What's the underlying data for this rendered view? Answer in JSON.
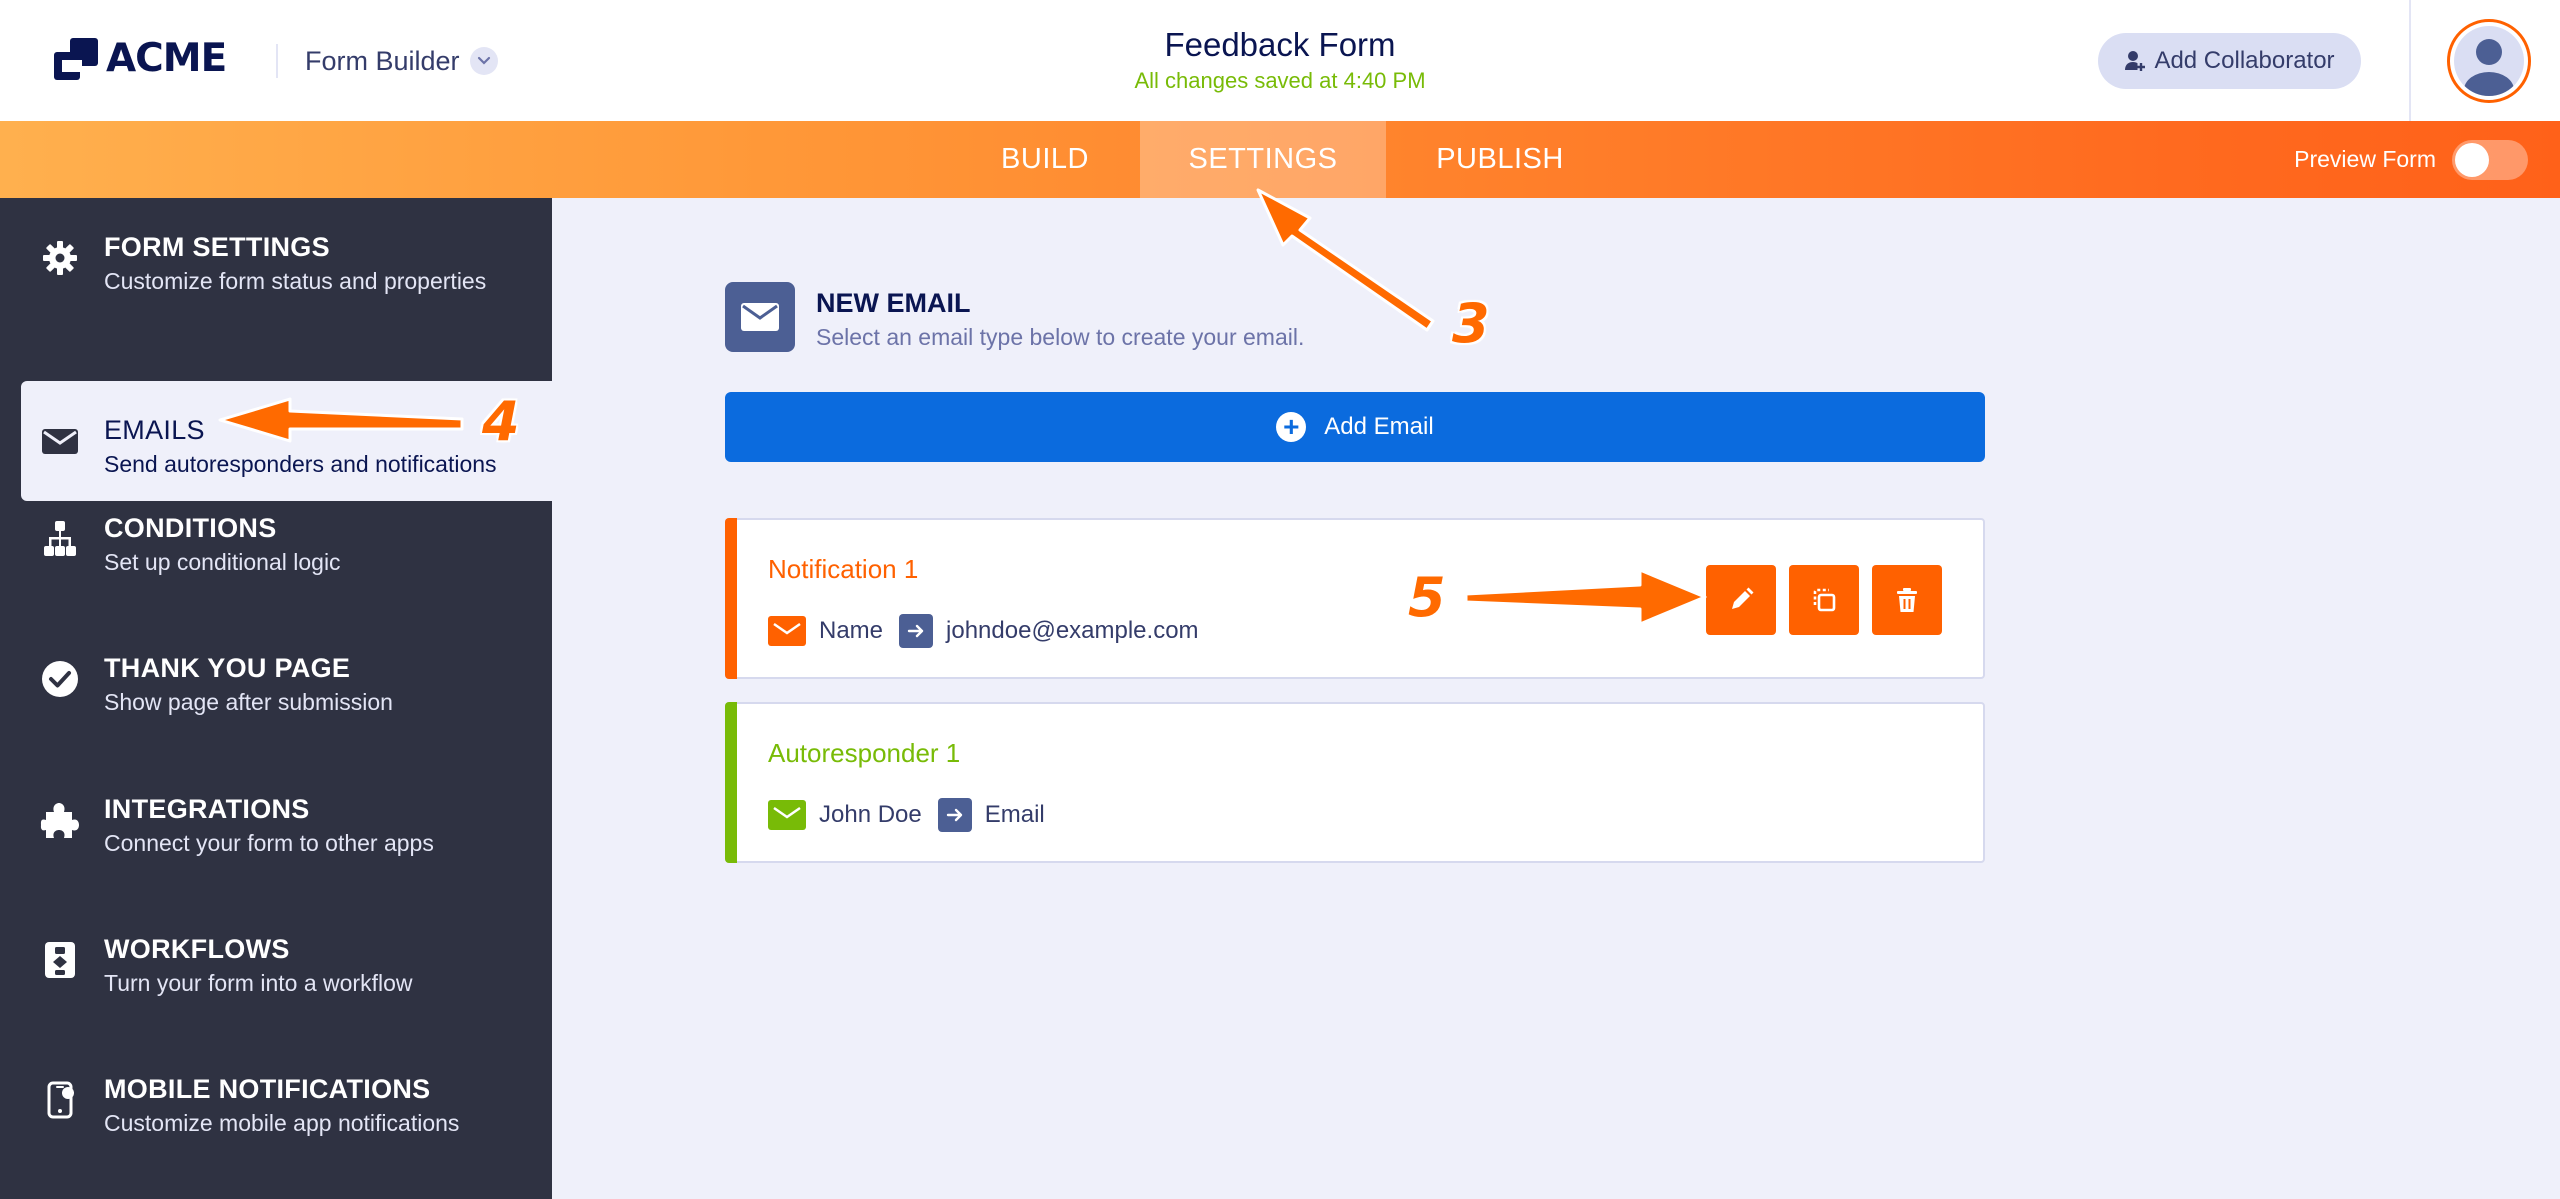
{
  "header": {
    "logo_text": "ACME",
    "builder_label": "Form Builder",
    "form_title": "Feedback Form",
    "save_status": "All changes saved at 4:40 PM",
    "collaborator_label": "Add Collaborator"
  },
  "nav": {
    "tabs": [
      {
        "label": "BUILD",
        "active": false
      },
      {
        "label": "SETTINGS",
        "active": true
      },
      {
        "label": "PUBLISH",
        "active": false
      }
    ],
    "preview_label": "Preview Form",
    "preview_on": false
  },
  "sidebar": {
    "items": [
      {
        "title": "FORM SETTINGS",
        "subtitle": "Customize form status and properties",
        "icon": "gear-icon"
      },
      {
        "title": "EMAILS",
        "subtitle": "Send autoresponders and notifications",
        "icon": "envelope-icon",
        "active": true
      },
      {
        "title": "CONDITIONS",
        "subtitle": "Set up conditional logic",
        "icon": "hierarchy-icon"
      },
      {
        "title": "THANK YOU PAGE",
        "subtitle": "Show page after submission",
        "icon": "check-circle-icon"
      },
      {
        "title": "INTEGRATIONS",
        "subtitle": "Connect your form to other apps",
        "icon": "puzzle-icon"
      },
      {
        "title": "WORKFLOWS",
        "subtitle": "Turn your form into a workflow",
        "icon": "workflow-icon"
      },
      {
        "title": "MOBILE NOTIFICATIONS",
        "subtitle": "Customize mobile app notifications",
        "icon": "mobile-icon"
      }
    ]
  },
  "main": {
    "new_email_title": "NEW EMAIL",
    "new_email_subtitle": "Select an email type below to create your email.",
    "add_email_label": "Add Email",
    "emails": [
      {
        "title": "Notification 1",
        "from": "Name",
        "to": "johndoe@example.com",
        "color": "#ff6100"
      },
      {
        "title": "Autoresponder 1",
        "from": "John Doe",
        "to": "Email",
        "color": "#78bb07"
      }
    ]
  },
  "annotations": {
    "step3": "3",
    "step4": "4",
    "step5": "5"
  },
  "colors": {
    "accent": "#ff6100",
    "primary_blue": "#0b6bde",
    "sidebar_bg": "#2f3242",
    "success_green": "#78bb07",
    "navy": "#0a1551"
  }
}
